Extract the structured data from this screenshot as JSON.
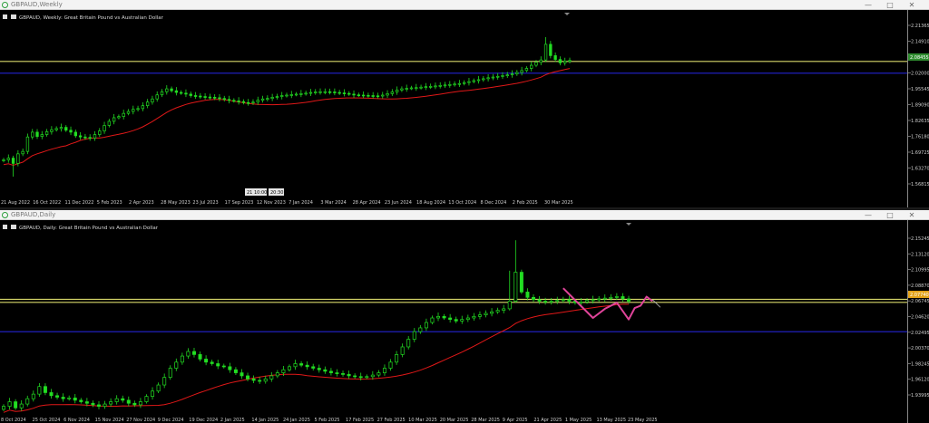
{
  "weekly": {
    "window_title": "GBPAUD,Weekly",
    "header": "GBPAUD, Weekly:  Great Britain Pound vs Australian Dollar",
    "price_labels": [
      "2.21365",
      "2.14910",
      "2.08455",
      "2.02000",
      "1.95545",
      "1.89090",
      "1.82635",
      "1.76180",
      "1.69725",
      "1.63270",
      "1.56815"
    ],
    "highlight_price": "2.08455",
    "date_labels": [
      "21 Aug 2022",
      "16 Oct 2022",
      "11 Dec 2022",
      "5 Feb 2023",
      "2 Apr 2023",
      "28 May 2023",
      "23 Jul 2023",
      "17 Sep 2023",
      "12 Nov 2023",
      "7 Jan 2024",
      "3 Mar 2024",
      "28 Apr 2024",
      "23 Jun 2024",
      "18 Aug 2024",
      "13 Oct 2024",
      "8 Dec 2024",
      "2 Feb 2025",
      "30 Mar 2025"
    ],
    "crosshair_date": "21 10:00",
    "crosshair_time": "20:30",
    "colors": {
      "candle": "#22dd22",
      "ma": "#e01818",
      "level_yellow": "#d8d86a",
      "level_blue": "#2323d0",
      "badge": "#2f8c2f"
    }
  },
  "daily": {
    "window_title": "GBPAUD,Daily",
    "header": "GBPAUD, Daily:  Great Britain Pound vs Australian Dollar",
    "price_labels": [
      "2.15245",
      "2.13120",
      "2.10995",
      "2.08870",
      "2.06745",
      "2.04620",
      "2.02495",
      "2.00370",
      "1.98245",
      "1.96120",
      "1.93995"
    ],
    "highlight_price": "2.07740",
    "date_labels": [
      "8 Oct 2024",
      "25 Oct 2024",
      "6 Nov 2024",
      "15 Nov 2024",
      "27 Nov 2024",
      "9 Dec 2024",
      "19 Dec 2024",
      "2 Jan 2025",
      "14 Jan 2025",
      "24 Jan 2025",
      "5 Feb 2025",
      "17 Feb 2025",
      "27 Feb 2025",
      "10 Mar 2025",
      "20 Mar 2025",
      "28 Mar 2025",
      "9 Apr 2025",
      "21 Apr 2025",
      "1 May 2025",
      "13 May 2025",
      "23 May 2025"
    ],
    "colors": {
      "candle": "#22dd22",
      "ma": "#e01818",
      "level_yellow": "#d8d86a",
      "level_blue": "#2323d0",
      "pattern": "#e0449a",
      "badge": "#e3a21a"
    }
  },
  "chart_data": [
    {
      "type": "candlestick",
      "title": "GBPAUD, Weekly:  Great Britain Pound vs Australian Dollar",
      "ylim": [
        1.545,
        2.245
      ],
      "levels": [
        2.084,
        2.035
      ],
      "close": [
        1.675,
        1.682,
        1.66,
        1.7,
        1.71,
        1.77,
        1.79,
        1.772,
        1.78,
        1.792,
        1.8,
        1.805,
        1.81,
        1.798,
        1.79,
        1.775,
        1.77,
        1.768,
        1.765,
        1.78,
        1.795,
        1.818,
        1.835,
        1.85,
        1.855,
        1.868,
        1.876,
        1.885,
        1.888,
        1.9,
        1.915,
        1.928,
        1.945,
        1.958,
        1.97,
        1.962,
        1.955,
        1.952,
        1.948,
        1.942,
        1.94,
        1.938,
        1.936,
        1.935,
        1.933,
        1.93,
        1.926,
        1.922,
        1.92,
        1.917,
        1.913,
        1.912,
        1.915,
        1.923,
        1.928,
        1.93,
        1.935,
        1.938,
        1.942,
        1.944,
        1.946,
        1.948,
        1.95,
        1.952,
        1.955,
        1.957,
        1.958,
        1.958,
        1.957,
        1.955,
        1.953,
        1.951,
        1.948,
        1.945,
        1.944,
        1.943,
        1.942,
        1.941,
        1.94,
        1.944,
        1.95,
        1.957,
        1.965,
        1.97,
        1.972,
        1.974,
        1.975,
        1.977,
        1.979,
        1.98,
        1.982,
        1.984,
        1.986,
        1.988,
        1.99,
        1.992,
        1.996,
        2.0,
        2.004,
        2.008,
        2.012,
        2.016,
        2.019,
        2.022,
        2.025,
        2.028,
        2.032,
        2.038,
        2.046,
        2.055,
        2.068,
        2.08,
        2.09,
        2.155,
        2.108,
        2.092,
        2.078,
        2.085,
        2.088
      ]
    },
    {
      "type": "candlestick",
      "title": "GBPAUD, Daily:  Great Britain Pound vs Australian Dollar",
      "ylim": [
        1.932,
        2.165
      ],
      "levels": [
        2.0825,
        2.0785,
        2.04
      ],
      "close": [
        1.942,
        1.948,
        1.94,
        1.945,
        1.952,
        1.958,
        1.968,
        1.96,
        1.956,
        1.954,
        1.952,
        1.953,
        1.95,
        1.948,
        1.946,
        1.944,
        1.942,
        1.945,
        1.948,
        1.952,
        1.95,
        1.946,
        1.944,
        1.948,
        1.955,
        1.962,
        1.97,
        1.98,
        1.992,
        2.0,
        2.008,
        2.014,
        2.01,
        2.004,
        2.0,
        1.998,
        1.995,
        1.994,
        1.99,
        1.986,
        1.982,
        1.978,
        1.976,
        1.975,
        1.978,
        1.982,
        1.986,
        1.99,
        1.994,
        1.998,
        1.996,
        1.994,
        1.992,
        1.99,
        1.988,
        1.986,
        1.985,
        1.984,
        1.982,
        1.981,
        1.98,
        1.981,
        1.983,
        1.986,
        1.992,
        2.0,
        2.01,
        2.02,
        2.03,
        2.04,
        2.045,
        2.052,
        2.058,
        2.06,
        2.058,
        2.056,
        2.054,
        2.056,
        2.058,
        2.06,
        2.062,
        2.064,
        2.066,
        2.068,
        2.07,
        2.08,
        2.118,
        2.092,
        2.085,
        2.082,
        2.08,
        2.079,
        2.08,
        2.081,
        2.082,
        2.08,
        2.078,
        2.079,
        2.081,
        2.082,
        2.083,
        2.084,
        2.085,
        2.086,
        2.083,
        2.08
      ]
    }
  ]
}
